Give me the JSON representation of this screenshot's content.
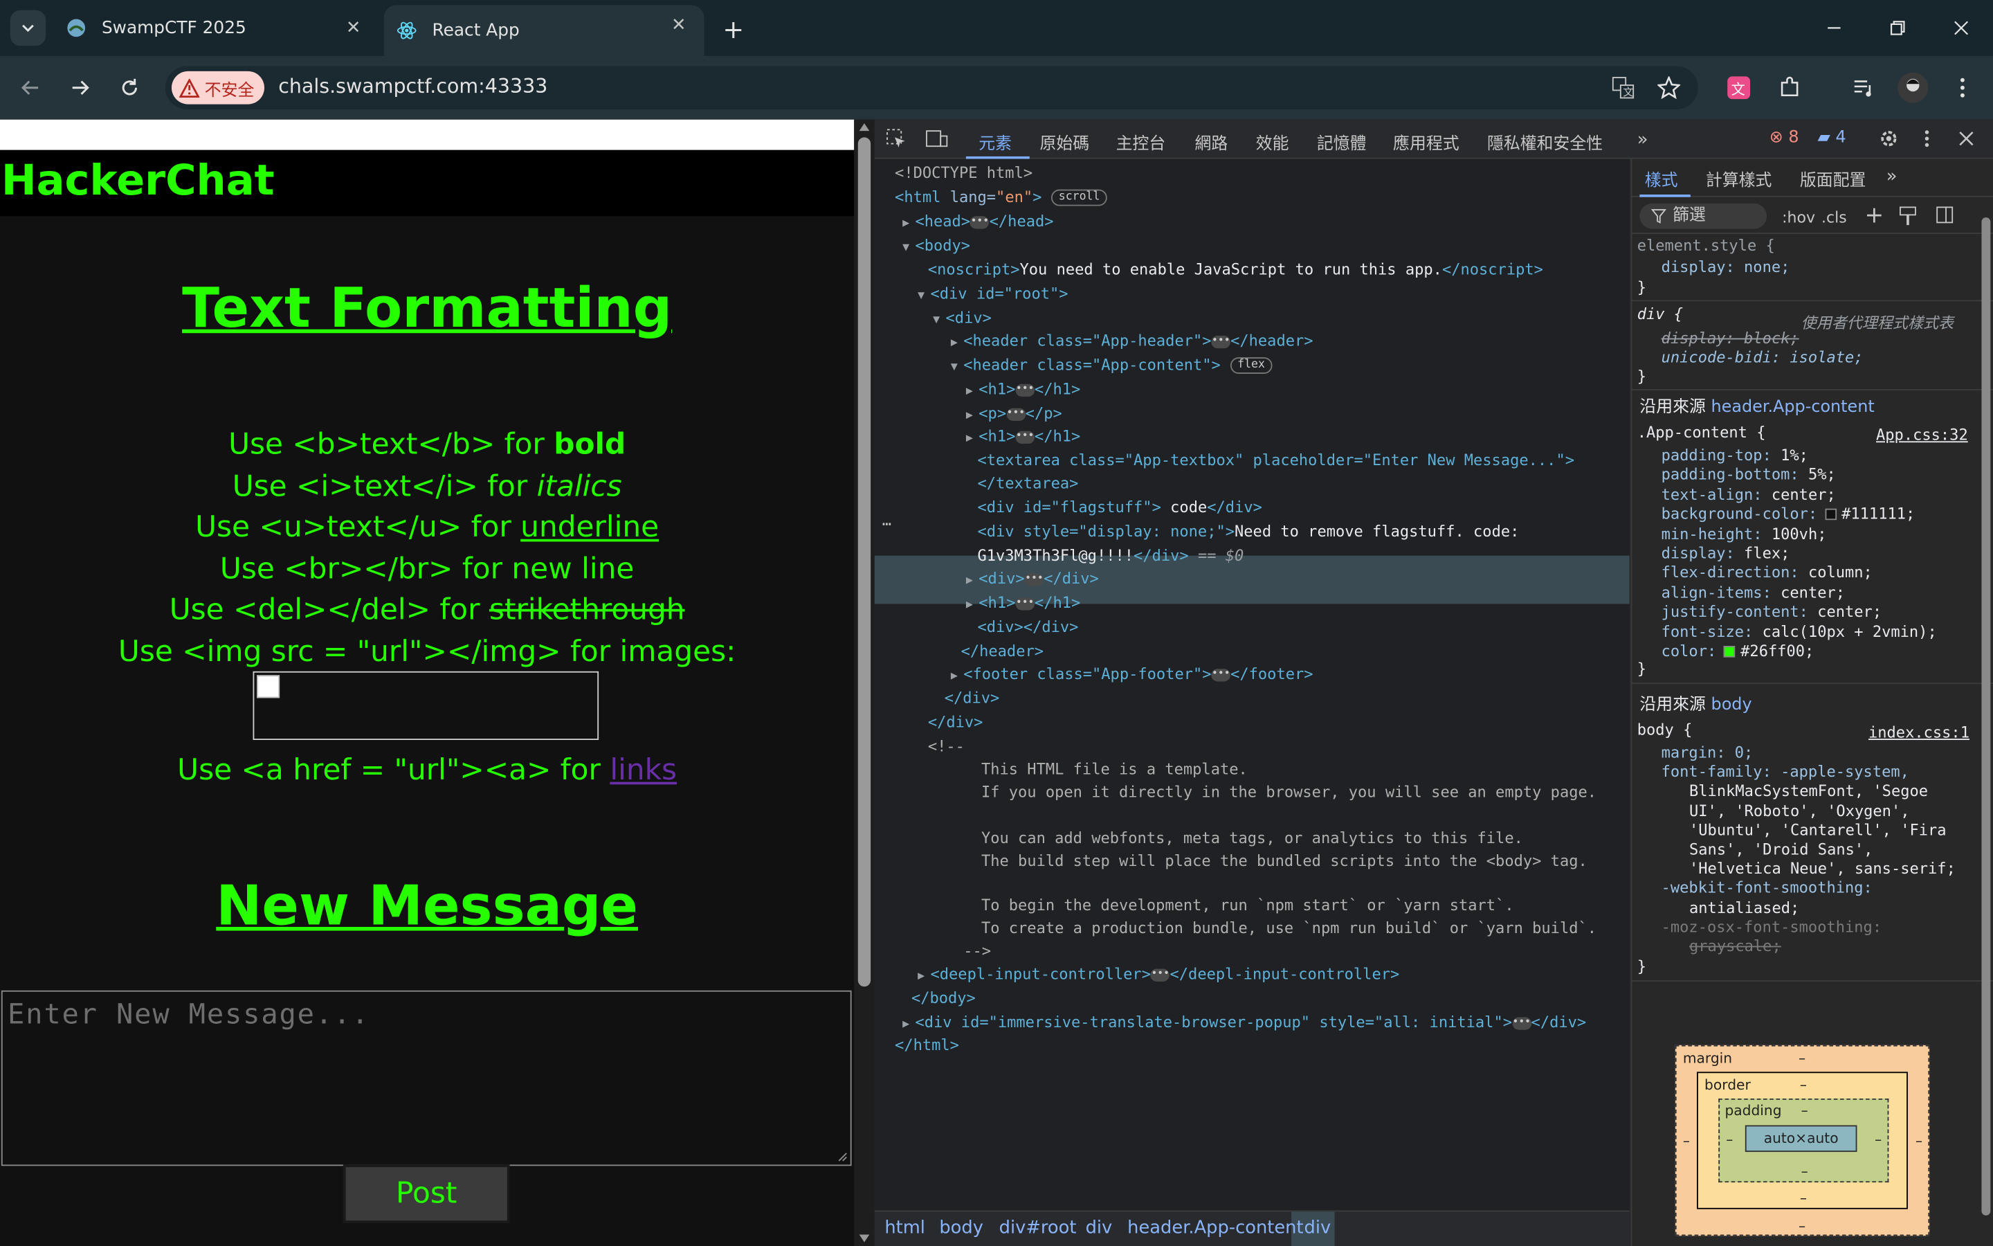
{
  "browser": {
    "tabs": [
      {
        "title": "SwampCTF 2025",
        "active": false
      },
      {
        "title": "React App",
        "active": true
      }
    ],
    "security_label": "不安全",
    "url": "chals.swampctf.com:43333"
  },
  "page": {
    "site_title": "HackerChat",
    "heading_formatting": "Text Formatting",
    "lines": [
      {
        "pre": "Use <b>text</b> for ",
        "sample": "bold"
      },
      {
        "pre": "Use <i>text</i> for ",
        "sample": "italics"
      },
      {
        "pre": "Use <u>text</u> for ",
        "sample": "underline"
      },
      {
        "pre": "Use <br></br> for new line",
        "sample": ""
      },
      {
        "pre": "Use <del></del> for ",
        "sample": "strikethrough"
      },
      {
        "pre": "Use <img src = \"url\"></img> for images:",
        "sample": ""
      },
      {
        "pre": "Use <a href = \"url\"><a> for ",
        "sample": "links"
      }
    ],
    "heading_new_message": "New Message",
    "message_placeholder": "Enter New Message...",
    "post_label": "Post"
  },
  "devtools": {
    "tabs": [
      "元素",
      "原始碼",
      "主控台",
      "網路",
      "效能",
      "記憶體",
      "應用程式",
      "隱私權和安全性"
    ],
    "error_count": "8",
    "message_count": "4",
    "dom": {
      "doctype": "<!DOCTYPE html>",
      "html_open_tag": "<html",
      "html_lang_attr": "lang=",
      "html_lang_val": "\"en\"",
      "scroll_badge": "scroll",
      "head": "<head>",
      "head_close": "</head>",
      "body_open": "<body>",
      "noscript_open": "<noscript>",
      "noscript_text": "You need to enable JavaScript to run this app.",
      "noscript_close": "</noscript>",
      "root_open": "<div id=\"root\">",
      "div_open": "<div>",
      "header1": "<header class=\"App-header\">",
      "header1_close": "</header>",
      "header2": "<header class=\"App-content\">",
      "flex_badge": "flex",
      "h1_a": "<h1>",
      "h1_close": "</h1>",
      "p_a": "<p>",
      "p_close": "</p>",
      "textarea_line": "<textarea class=\"App-textbox\" placeholder=\"Enter New Message...\">",
      "textarea_close": "</textarea>",
      "flagstuff_open": "<div id=\"flagstuff\"",
      "flagstuff_text": " code",
      "flagstuff_close": "</div>",
      "hidden_div_open": "<div style=\"display: none;\">",
      "hidden_text_1": "Need to remove flagstuff. code:",
      "hidden_text_2": "G1v3M3Th3Fl@g!!!!",
      "hidden_div_close": "</div>",
      "dollar0": " == $0",
      "div_close": "</div>",
      "empty_div": "<div></div>",
      "header_close": "</header>",
      "footer_open": "<footer class=\"App-footer\">",
      "footer_close": "</footer>",
      "comment_open": "<!--",
      "comment_lines": [
        "This HTML file is a template.",
        "If you open it directly in the browser, you will see an empty page.",
        "",
        "You can add webfonts, meta tags, or analytics to this file.",
        "The build step will place the bundled scripts into the <body> tag.",
        "",
        "To begin the development, run `npm start` or `yarn start`.",
        "To create a production bundle, use `npm run build` or `yarn build`."
      ],
      "comment_close": "-->",
      "deepl_open": "<deepl-input-controller>",
      "deepl_close": "</deepl-input-controller>",
      "body_close": "</body>",
      "popup_open": "<div id=\"immersive-translate-browser-popup\" style=\"all: initial\">",
      "popup_close": "</div>",
      "html_close": "</html>"
    },
    "breadcrumbs": [
      "html",
      "body",
      "div#root",
      "div",
      "header.App-content",
      "div"
    ],
    "styles": {
      "tabs": [
        "樣式",
        "計算樣式",
        "版面配置"
      ],
      "filter_placeholder": "篩選",
      "hov": ":hov",
      "cls": ".cls",
      "element_style": "element.style {",
      "element_display": "display: none;",
      "ua_selector": "div {",
      "ua_label": "使用者代理程式樣式表",
      "ua_display": "display: block;",
      "ua_bidi": "unicode-bidi: isolate;",
      "inherited_label": "沿用來源",
      "inherited_from_1": "header.App-content",
      "app_content_selector": ".App-content {",
      "app_css_source": "App.css:32",
      "app_rules": [
        "padding-top: 1%;",
        "padding-bottom: 5%;",
        "text-align: center;",
        "background-color: #111111;",
        "min-height: 100vh;",
        "display: flex;",
        "flex-direction: column;",
        "align-items: center;",
        "justify-content: center;",
        "font-size: calc(10px + 2vmin);",
        "color: #26ff00;"
      ],
      "inherited_from_2": "body",
      "body_selector": "body {",
      "index_css_source": "index.css:1",
      "body_rules": [
        "margin: 0;",
        "font-family: -apple-system,",
        "BlinkMacSystemFont, 'Segoe",
        "UI', 'Roboto', 'Oxygen',",
        "'Ubuntu', 'Cantarell', 'Fira",
        "Sans', 'Droid Sans',",
        "'Helvetica Neue', sans-serif;",
        "-webkit-font-smoothing:",
        "antialiased;",
        "-moz-osx-font-smoothing:",
        "grayscale;"
      ],
      "close_brace": "}",
      "box_margin": "margin",
      "box_border": "border",
      "box_padding": "padding",
      "box_content": "auto×auto",
      "box_dash": "–"
    },
    "colors": {
      "bg_swatch": "#111111",
      "fg_swatch": "#26ff00"
    }
  }
}
